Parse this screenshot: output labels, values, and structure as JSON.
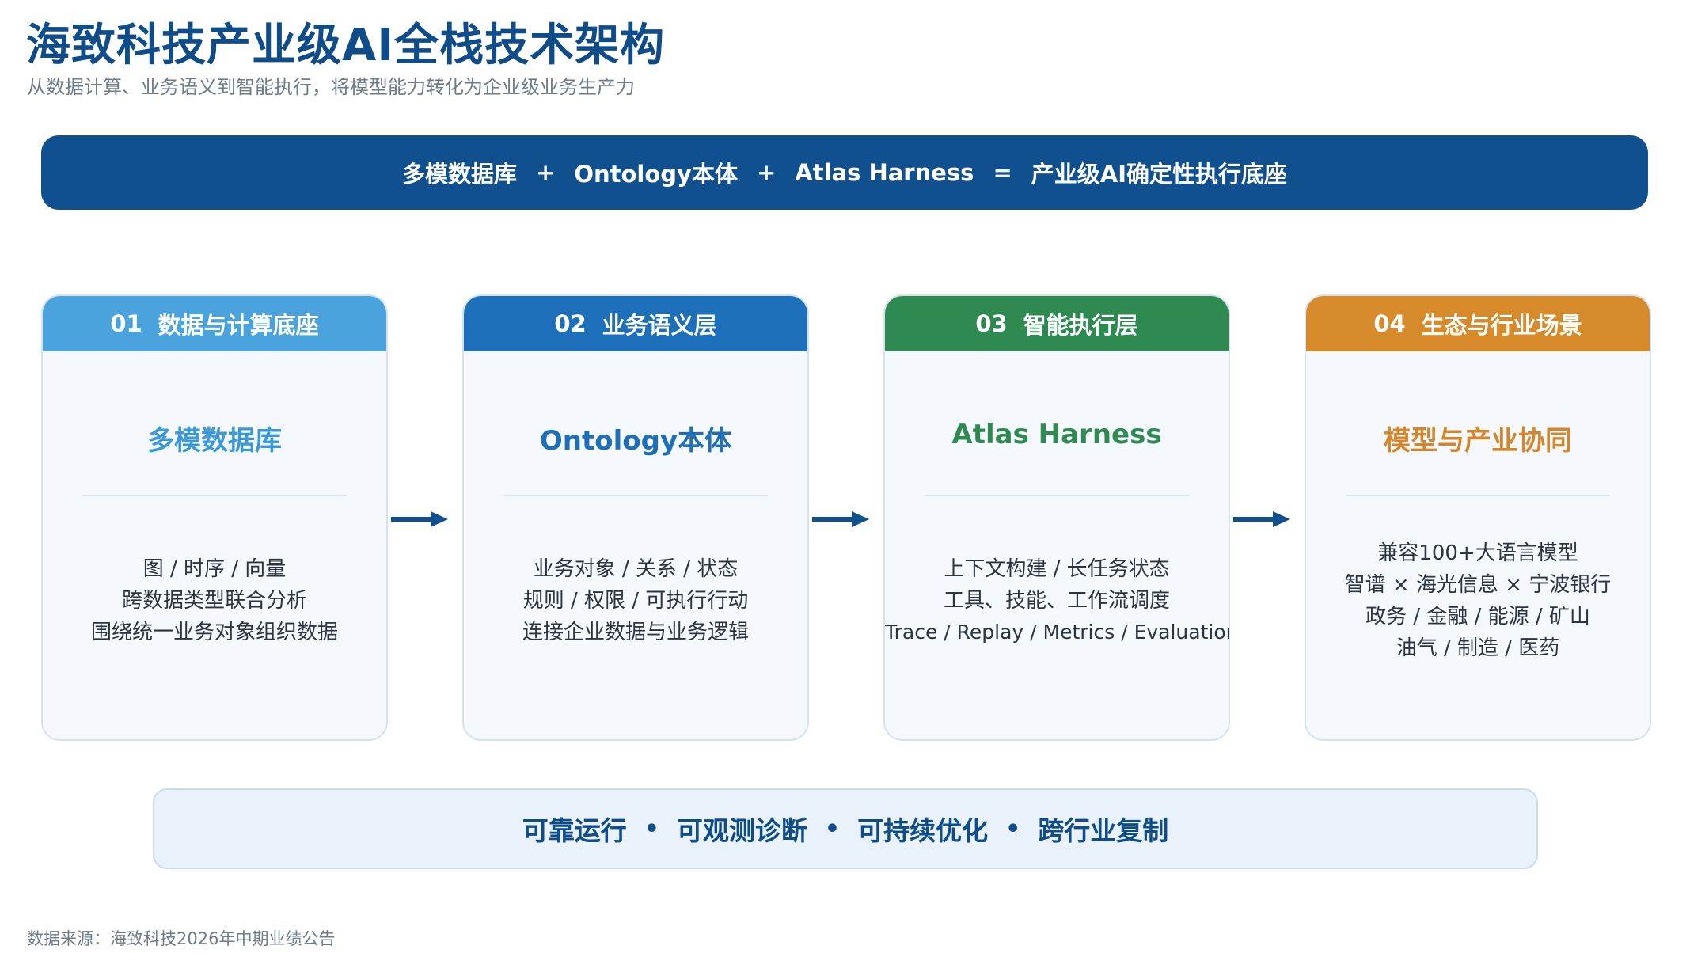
{
  "header": {
    "title": "海致科技产业级AI全栈技术架构",
    "subtitle": "从数据计算、业务语义到智能执行，将模型能力转化为企业级业务生产力"
  },
  "formula": {
    "term1": "多模数据库",
    "plus1": "+",
    "term2": "Ontology本体",
    "plus2": "+",
    "term3": "Atlas Harness",
    "equals": "=",
    "result": "产业级AI确定性执行底座"
  },
  "cards": [
    {
      "number": "01",
      "header": "数据与计算底座",
      "title": "多模数据库",
      "lines": [
        "图  /  时序  /  向量",
        "跨数据类型联合分析",
        "围绕统一业务对象组织数据"
      ],
      "header_color": "#4aa3dc",
      "title_color": "#3a98d6"
    },
    {
      "number": "02",
      "header": "业务语义层",
      "title": "Ontology本体",
      "lines": [
        "业务对象  /  关系  /  状态",
        "规则  /  权限  /  可执行行动",
        "连接企业数据与业务逻辑"
      ],
      "header_color": "#1d6fba",
      "title_color": "#1d6fba"
    },
    {
      "number": "03",
      "header": "智能执行层",
      "title": "Atlas Harness",
      "lines": [
        "上下文构建  /  长任务状态",
        "工具、技能、工作流调度",
        "Trace / Replay / Metrics / Evaluation"
      ],
      "header_color": "#2f8a52",
      "title_color": "#2f8a52"
    },
    {
      "number": "04",
      "header": "生态与行业场景",
      "title": "模型与产业协同",
      "lines": [
        "兼容100+大语言模型",
        "智谱 × 海光信息 × 宁波银行",
        "政务 / 金融 / 能源 / 矿山",
        "油气 / 制造 / 医药"
      ],
      "header_color": "#d68a2a",
      "title_color": "#d6862a"
    }
  ],
  "arrow_color": "#11508e",
  "bottom": {
    "items": [
      "可靠运行",
      "可观测诊断",
      "可持续优化",
      "跨行业复制"
    ],
    "separator": "•"
  },
  "source": "数据来源：海致科技2026年中期业绩公告"
}
